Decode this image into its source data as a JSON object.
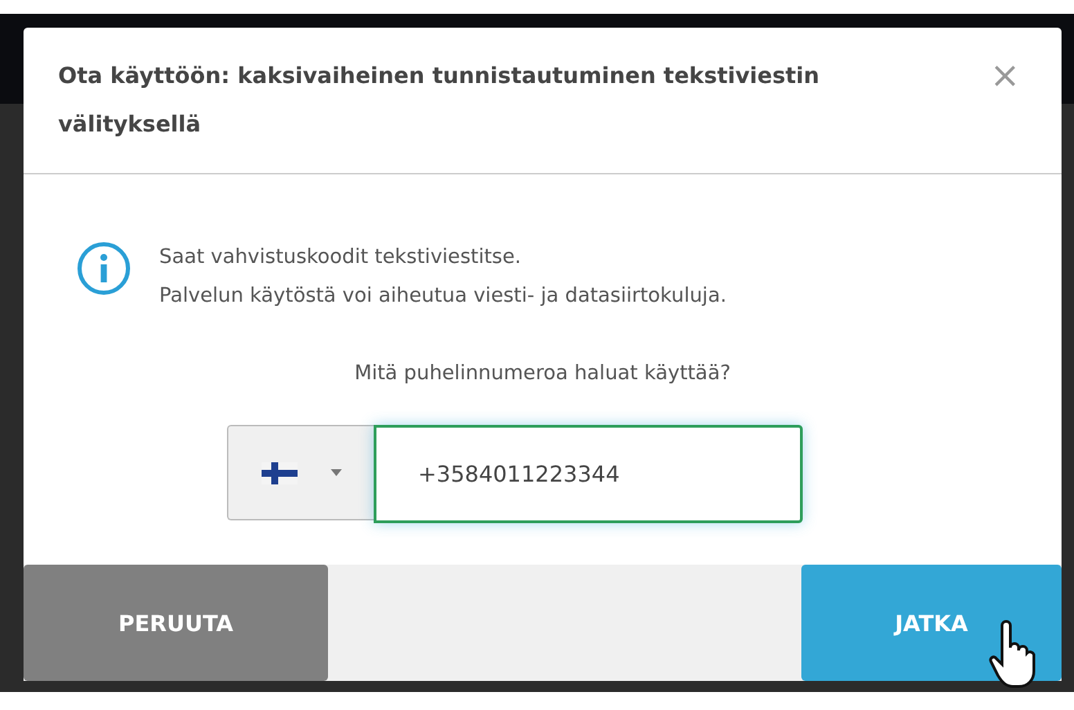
{
  "dialog": {
    "title": "Ota käyttöön: kaksivaiheinen tunnistautuminen tekstiviestin välityksellä",
    "close": "×"
  },
  "info": {
    "lines": [
      "Saat vahvistuskoodit tekstiviestitse.",
      "Palvelun käytöstä voi aiheutua viesti- ja datasiirtokuluja."
    ]
  },
  "question": "Mitä puhelinnumeroa haluat käyttää?",
  "phone": {
    "flag": {
      "kind": "finland"
    },
    "value": "+3584011223344",
    "focused": true
  },
  "buttons": [
    {
      "label": "PERUUTA",
      "kind": "secondary"
    },
    {
      "label": "JATKA",
      "kind": "primary"
    }
  ]
}
